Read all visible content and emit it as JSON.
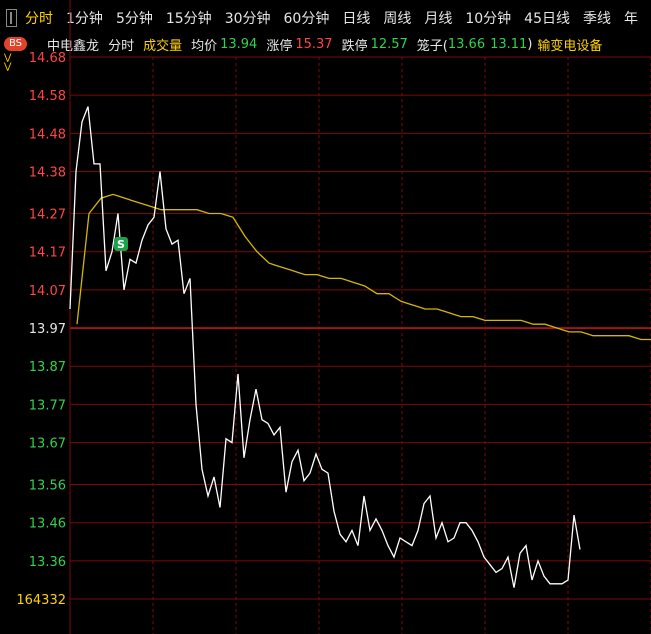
{
  "tabs": [
    "分时",
    "1分钟",
    "5分钟",
    "15分钟",
    "30分钟",
    "60分钟",
    "日线",
    "周线",
    "月线",
    "10分钟",
    "45日线",
    "季线",
    "年"
  ],
  "active_tab": 0,
  "info": {
    "badge": "BS",
    "stock_name": "中电鑫龙",
    "mode": "分时",
    "volume_label": "成交量",
    "avg_label": "均价",
    "avg_value": "13.94",
    "limit_up_label": "涨停",
    "limit_up_value": "15.37",
    "limit_down_label": "跌停",
    "limit_down_value": "12.57",
    "cage_label": "笼子(",
    "cage_low": "13.66",
    "cage_high": "13.11",
    "cage_close": ")",
    "sector": "输变电设备"
  },
  "colors": {
    "price_line": "#ffffff",
    "avg_line": "#d4b800",
    "grid": "#7a0a0a",
    "up": "#ff4545",
    "down": "#2fd34d",
    "signal_badge": "#1aa34a"
  },
  "signal_badge_text": "S",
  "chart_data": {
    "type": "line",
    "y_ticks": [
      "14.68",
      "14.58",
      "14.48",
      "14.38",
      "14.27",
      "14.17",
      "14.07",
      "13.97",
      "13.87",
      "13.77",
      "13.67",
      "13.56",
      "13.46",
      "13.36"
    ],
    "prev_close": 13.97,
    "volume_tick": "164332",
    "ylim": [
      13.31,
      14.68
    ],
    "signal_at": {
      "x": 8,
      "price": 14.19
    },
    "price_series": [
      14.02,
      14.38,
      14.51,
      14.55,
      14.4,
      14.4,
      14.12,
      14.17,
      14.27,
      14.07,
      14.15,
      14.14,
      14.2,
      14.24,
      14.26,
      14.38,
      14.23,
      14.19,
      14.2,
      14.06,
      14.1,
      13.77,
      13.6,
      13.53,
      13.58,
      13.5,
      13.68,
      13.67,
      13.85,
      13.63,
      13.73,
      13.81,
      13.73,
      13.72,
      13.69,
      13.71,
      13.54,
      13.62,
      13.65,
      13.57,
      13.59,
      13.64,
      13.6,
      13.59,
      13.49,
      13.43,
      13.41,
      13.44,
      13.4,
      13.53,
      13.44,
      13.47,
      13.44,
      13.4,
      13.37,
      13.42,
      13.41,
      13.4,
      13.44,
      13.51,
      13.53,
      13.42,
      13.46,
      13.41,
      13.42,
      13.46,
      13.46,
      13.44,
      13.41,
      13.37,
      13.35,
      13.33,
      13.34,
      13.37,
      13.29,
      13.38,
      13.4,
      13.31,
      13.36,
      13.32,
      13.3,
      13.3,
      13.3,
      13.31,
      13.48,
      13.39
    ],
    "avg_series": [
      13.98,
      14.27,
      14.31,
      14.32,
      14.31,
      14.3,
      14.29,
      14.28,
      14.28,
      14.28,
      14.28,
      14.27,
      14.27,
      14.26,
      14.21,
      14.17,
      14.14,
      14.13,
      14.12,
      14.11,
      14.11,
      14.1,
      14.1,
      14.09,
      14.08,
      14.06,
      14.06,
      14.04,
      14.03,
      14.02,
      14.02,
      14.01,
      14.0,
      14.0,
      13.99,
      13.99,
      13.99,
      13.99,
      13.98,
      13.98,
      13.97,
      13.96,
      13.96,
      13.95,
      13.95,
      13.95,
      13.95,
      13.94,
      13.94
    ]
  }
}
